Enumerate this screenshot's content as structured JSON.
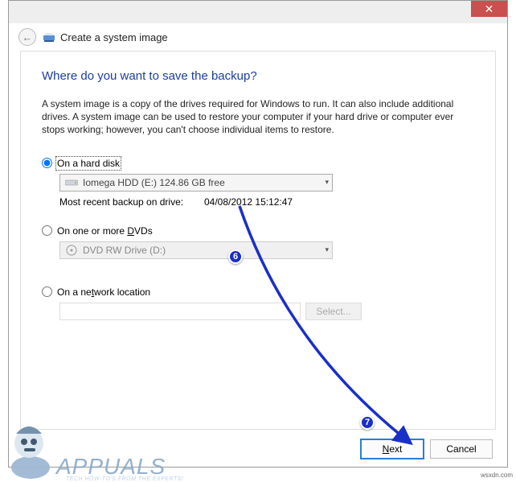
{
  "titlebar": {
    "close_glyph": "✕"
  },
  "header": {
    "title": "Create a system image"
  },
  "content": {
    "heading": "Where do you want to save the backup?",
    "description": "A system image is a copy of the drives required for Windows to run. It can also include additional drives. A system image can be used to restore your computer if your hard drive or computer ever stops working; however, you can't choose individual items to restore.",
    "options": {
      "hard_disk": {
        "label": "On a hard disk",
        "dropdown_value": "Iomega HDD (E:)  124.86 GB free",
        "recent_label": "Most recent backup on drive:",
        "recent_value": "04/08/2012 15:12:47"
      },
      "dvds": {
        "label": "On one or more DVDs",
        "dropdown_value": "DVD RW Drive (D:)"
      },
      "network": {
        "label": "On a network location",
        "select_btn": "Select..."
      }
    }
  },
  "footer": {
    "next_html": "Next",
    "cancel": "Cancel"
  },
  "annotations": {
    "badge6": "6",
    "badge7": "7"
  },
  "watermark": {
    "brand": "APPUALS",
    "tagline": "TECH HOW-TO'S FROM THE EXPERTS!"
  },
  "origin": "wsxdn.com"
}
